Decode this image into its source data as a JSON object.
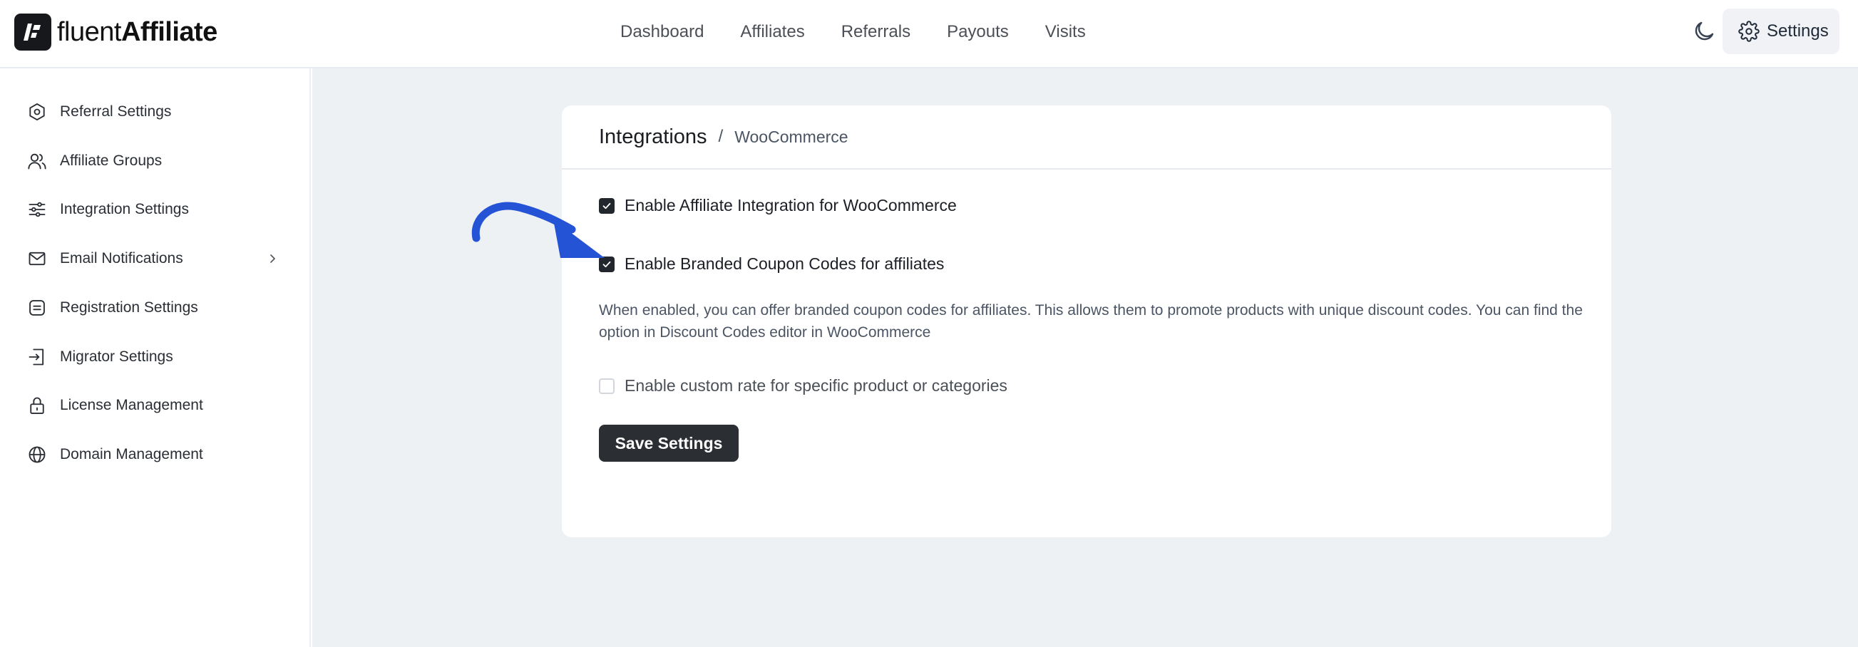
{
  "brand": {
    "name_light": "fluent",
    "name_bold": "Affiliate",
    "logo_icon": "fluent-logo-icon"
  },
  "nav": {
    "items": [
      {
        "label": "Dashboard"
      },
      {
        "label": "Affiliates"
      },
      {
        "label": "Referrals"
      },
      {
        "label": "Payouts"
      },
      {
        "label": "Visits"
      }
    ],
    "theme_icon": "moon-icon",
    "settings_label": "Settings",
    "settings_icon": "gear-icon"
  },
  "sidebar": {
    "items": [
      {
        "label": "Referral Settings",
        "icon": "hexagon-settings-icon"
      },
      {
        "label": "Affiliate Groups",
        "icon": "users-icon"
      },
      {
        "label": "Integration Settings",
        "icon": "sliders-icon"
      },
      {
        "label": "Email Notifications",
        "icon": "mail-icon",
        "has_submenu": true
      },
      {
        "label": "Registration Settings",
        "icon": "form-icon"
      },
      {
        "label": "Migrator Settings",
        "icon": "import-icon"
      },
      {
        "label": "License Management",
        "icon": "lock-icon"
      },
      {
        "label": "Domain Management",
        "icon": "globe-icon"
      }
    ]
  },
  "card": {
    "breadcrumb_title": "Integrations",
    "breadcrumb_separator": "/",
    "breadcrumb_current": "WooCommerce",
    "options": [
      {
        "label": "Enable Affiliate Integration for WooCommerce",
        "checked": true
      },
      {
        "label": "Enable Branded Coupon Codes for affiliates",
        "checked": true
      },
      {
        "label": "Enable custom rate for specific product or categories",
        "checked": false
      }
    ],
    "description": "When enabled, you can offer branded coupon codes for affiliates. This allows them to promote products with unique discount codes. You can find the option in Discount Codes editor in WooCommerce",
    "save_label": "Save Settings"
  },
  "colors": {
    "accent_dark": "#2b2e33",
    "annotation_arrow": "#2453d6",
    "main_background": "#eef1f4"
  }
}
